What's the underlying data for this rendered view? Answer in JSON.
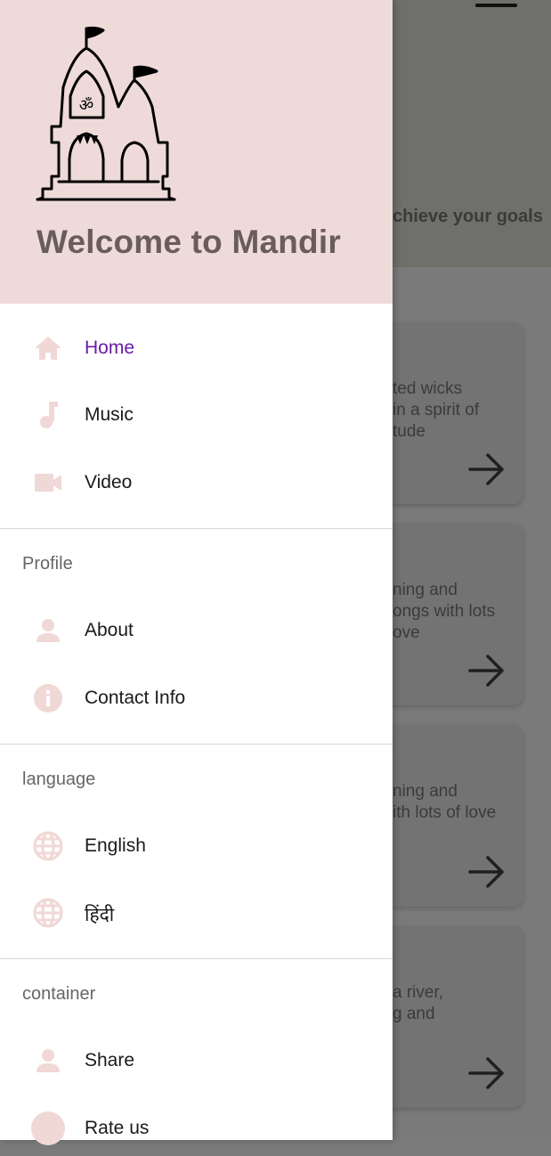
{
  "background": {
    "header_text": "chieve your goals",
    "cards": [
      {
        "lines": [
          "ted wicks",
          " in a spirit of",
          "tude"
        ]
      },
      {
        "lines": [
          "ning and",
          "ongs with lots",
          "ove"
        ]
      },
      {
        "lines": [
          "ning and",
          "ith lots of love"
        ]
      },
      {
        "lines": [
          "a river,",
          "g and"
        ]
      }
    ]
  },
  "drawer": {
    "title": "Welcome to Mandir",
    "logo_om": "ॐ",
    "nav": [
      {
        "label": "Home",
        "icon": "home-icon",
        "active": true
      },
      {
        "label": "Music",
        "icon": "music-note-icon"
      },
      {
        "label": "Video",
        "icon": "videocam-icon"
      }
    ],
    "profile": {
      "title": "Profile",
      "items": [
        {
          "label": "About",
          "icon": "person-icon"
        },
        {
          "label": "Contact Info",
          "icon": "info-icon"
        }
      ]
    },
    "language": {
      "title": "language",
      "items": [
        {
          "label": "English",
          "icon": "globe-icon"
        },
        {
          "label": "हिंदी",
          "icon": "globe-icon"
        }
      ]
    },
    "container": {
      "title": "container",
      "items": [
        {
          "label": "Share",
          "icon": "person-icon"
        },
        {
          "label": "Rate us",
          "icon": "circle-icon"
        }
      ]
    }
  },
  "colors": {
    "accent": "#6a1aa8",
    "header_bg": "#eedad8",
    "icon": "#f0d8d6",
    "title": "#695d5b"
  }
}
